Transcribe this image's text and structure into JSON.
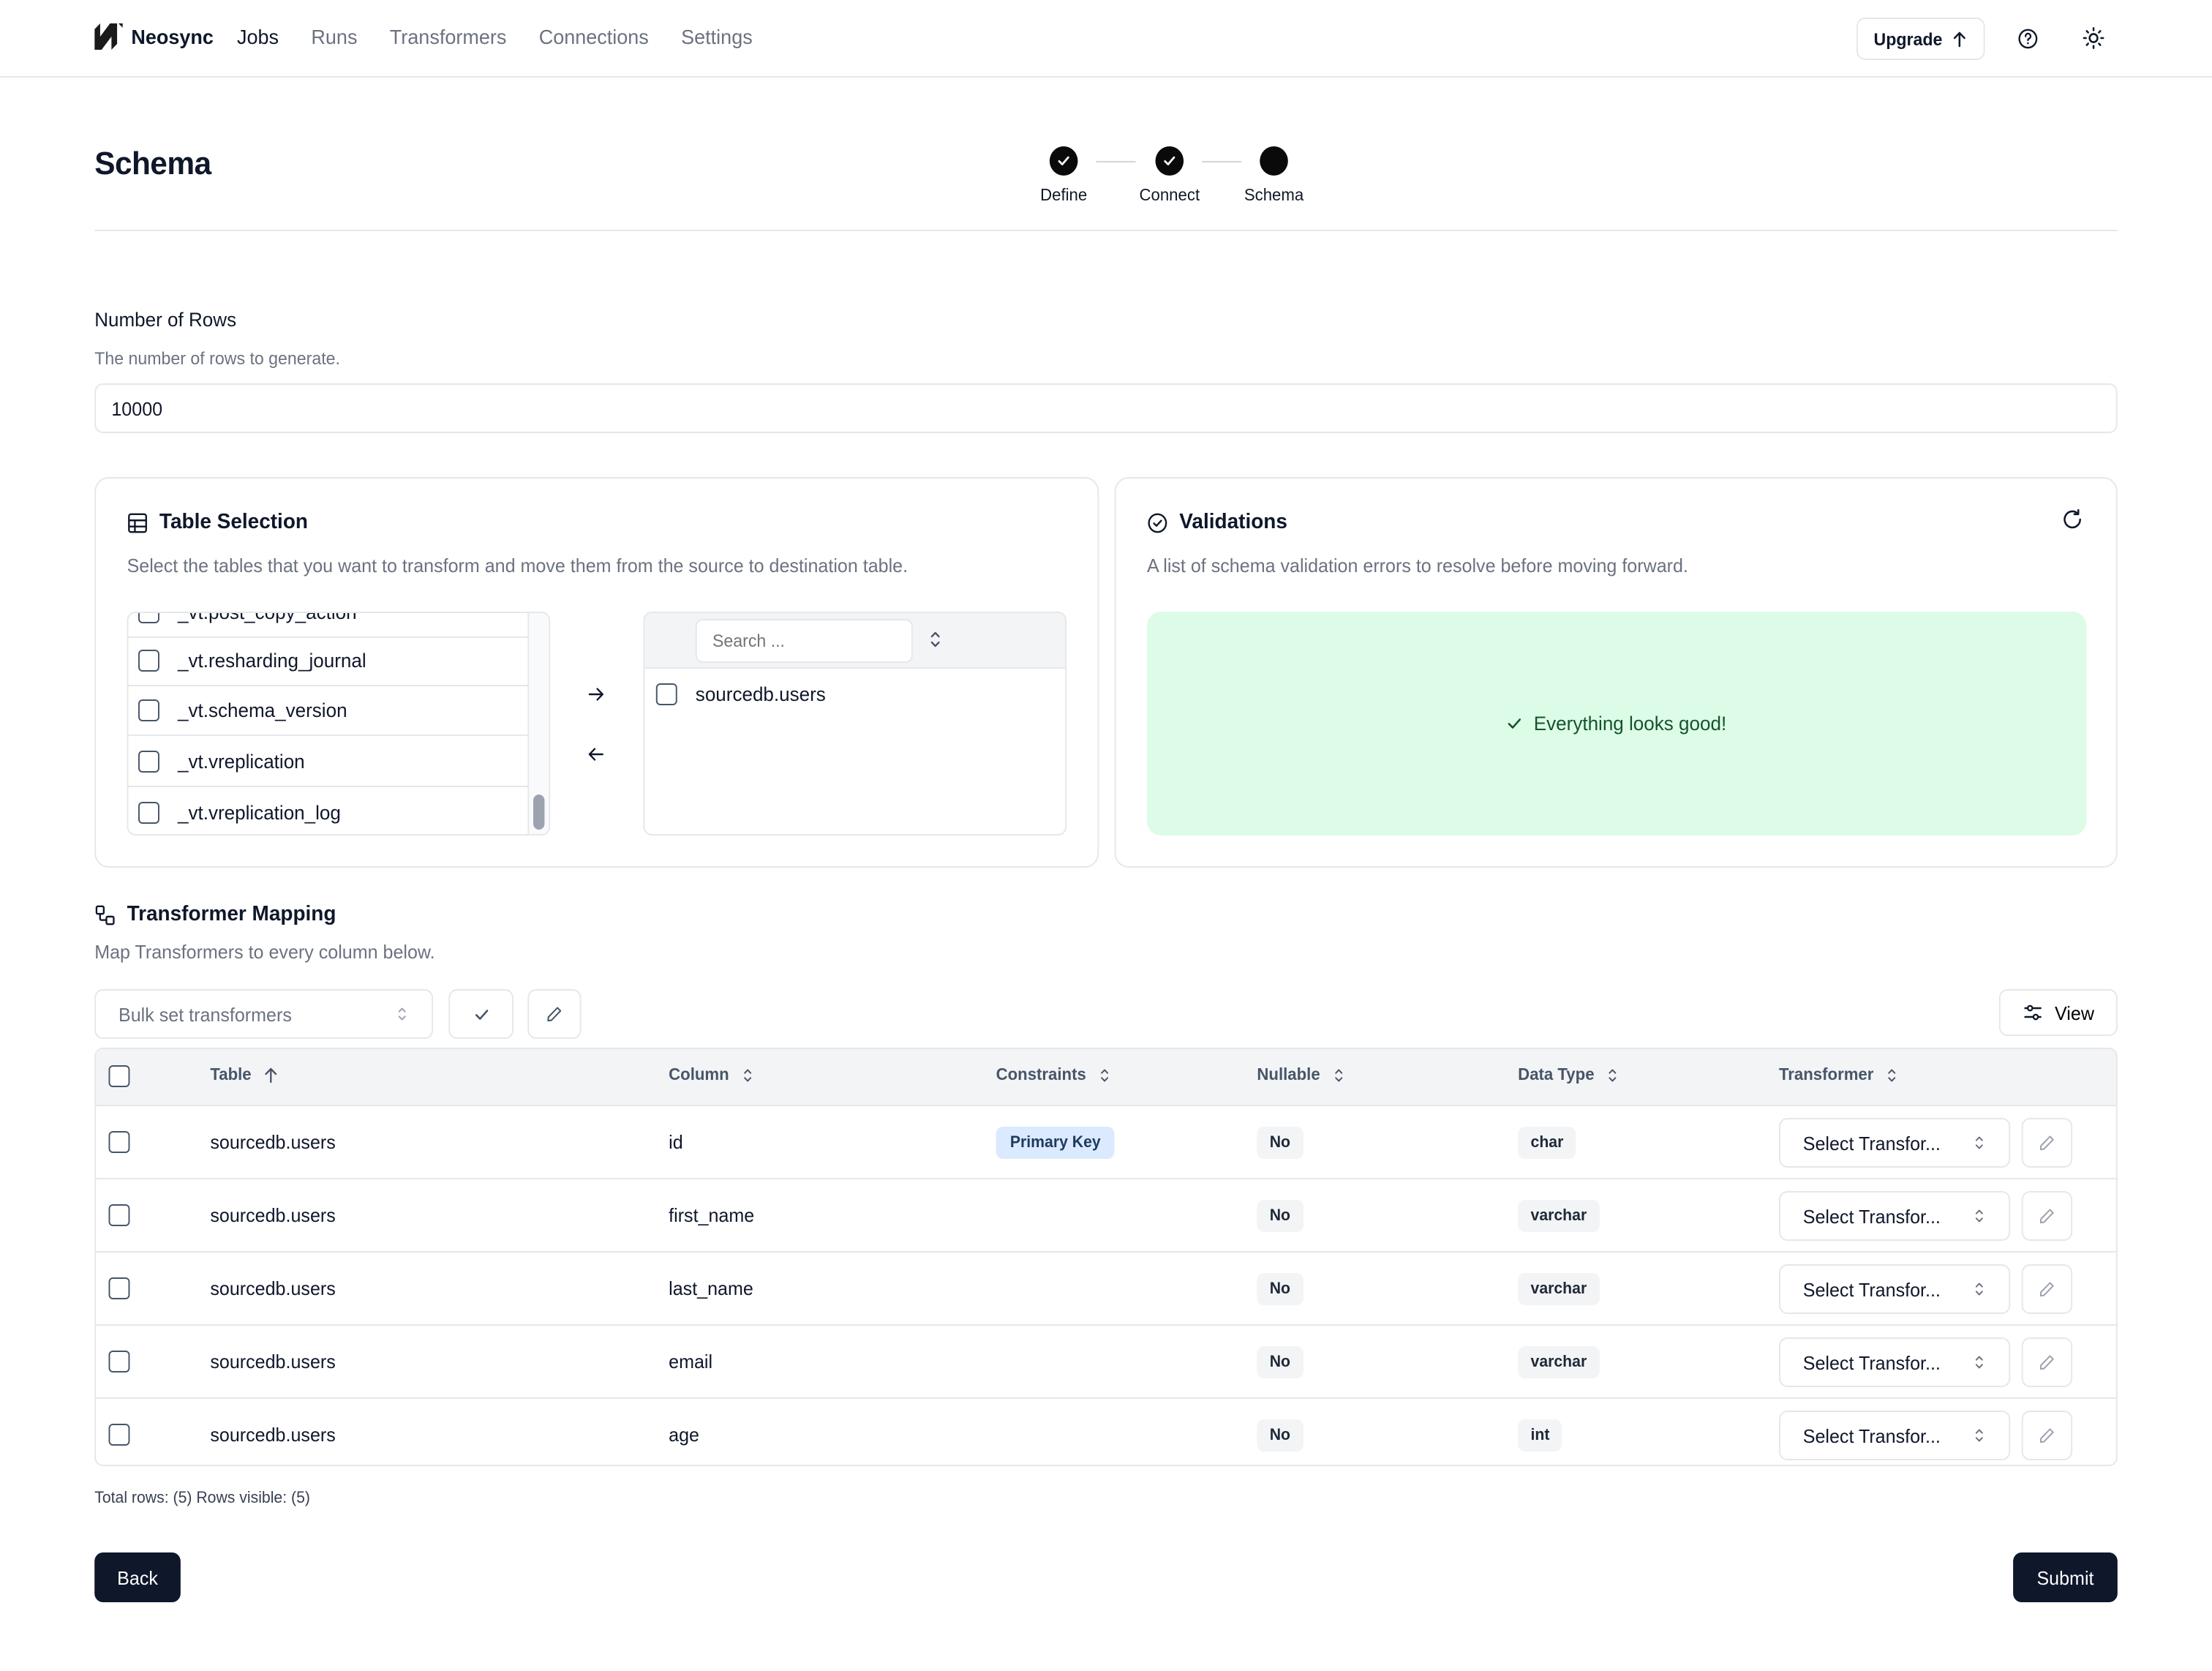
{
  "app": {
    "name": "Neosync",
    "nav": [
      {
        "label": "Jobs",
        "active": true
      },
      {
        "label": "Runs",
        "active": false
      },
      {
        "label": "Transformers",
        "active": false
      },
      {
        "label": "Connections",
        "active": false
      },
      {
        "label": "Settings",
        "active": false
      }
    ],
    "upgrade_label": "Upgrade"
  },
  "page": {
    "title": "Schema",
    "steps": [
      {
        "label": "Define",
        "status": "complete"
      },
      {
        "label": "Connect",
        "status": "complete"
      },
      {
        "label": "Schema",
        "status": "current"
      }
    ]
  },
  "rows_field": {
    "label": "Number of Rows",
    "description": "The number of rows to generate.",
    "value": "10000"
  },
  "table_selection": {
    "title": "Table Selection",
    "description": "Select the tables that you want to transform and move them from the source to destination table.",
    "source_items": [
      "_vt.post_copy_action",
      "_vt.resharding_journal",
      "_vt.schema_version",
      "_vt.vreplication",
      "_vt.vreplication_log"
    ],
    "search_placeholder": "Search ...",
    "destination_items": [
      "sourcedb.users"
    ]
  },
  "validations": {
    "title": "Validations",
    "description": "A list of schema validation errors to resolve before moving forward.",
    "status_message": "Everything looks good!"
  },
  "transformer_mapping": {
    "title": "Transformer Mapping",
    "description": "Map Transformers to every column below.",
    "bulk_placeholder": "Bulk set transformers",
    "view_label": "View",
    "columns": [
      "Table",
      "Column",
      "Constraints",
      "Nullable",
      "Data Type",
      "Transformer"
    ],
    "rows": [
      {
        "table": "sourcedb.users",
        "column": "id",
        "constraint": "Primary Key",
        "nullable": "No",
        "data_type": "char",
        "transformer": "Select Transfor..."
      },
      {
        "table": "sourcedb.users",
        "column": "first_name",
        "constraint": "",
        "nullable": "No",
        "data_type": "varchar",
        "transformer": "Select Transfor..."
      },
      {
        "table": "sourcedb.users",
        "column": "last_name",
        "constraint": "",
        "nullable": "No",
        "data_type": "varchar",
        "transformer": "Select Transfor..."
      },
      {
        "table": "sourcedb.users",
        "column": "email",
        "constraint": "",
        "nullable": "No",
        "data_type": "varchar",
        "transformer": "Select Transfor..."
      },
      {
        "table": "sourcedb.users",
        "column": "age",
        "constraint": "",
        "nullable": "No",
        "data_type": "int",
        "transformer": "Select Transfor..."
      }
    ],
    "footer": "Total rows: (5) Rows visible: (5)"
  },
  "actions": {
    "back_label": "Back",
    "submit_label": "Submit"
  },
  "colors": {
    "primary_dark": "#0f172a",
    "success_bg": "#dcfce7",
    "pk_badge_bg": "#dbeafe",
    "muted_text": "#6b7280"
  }
}
